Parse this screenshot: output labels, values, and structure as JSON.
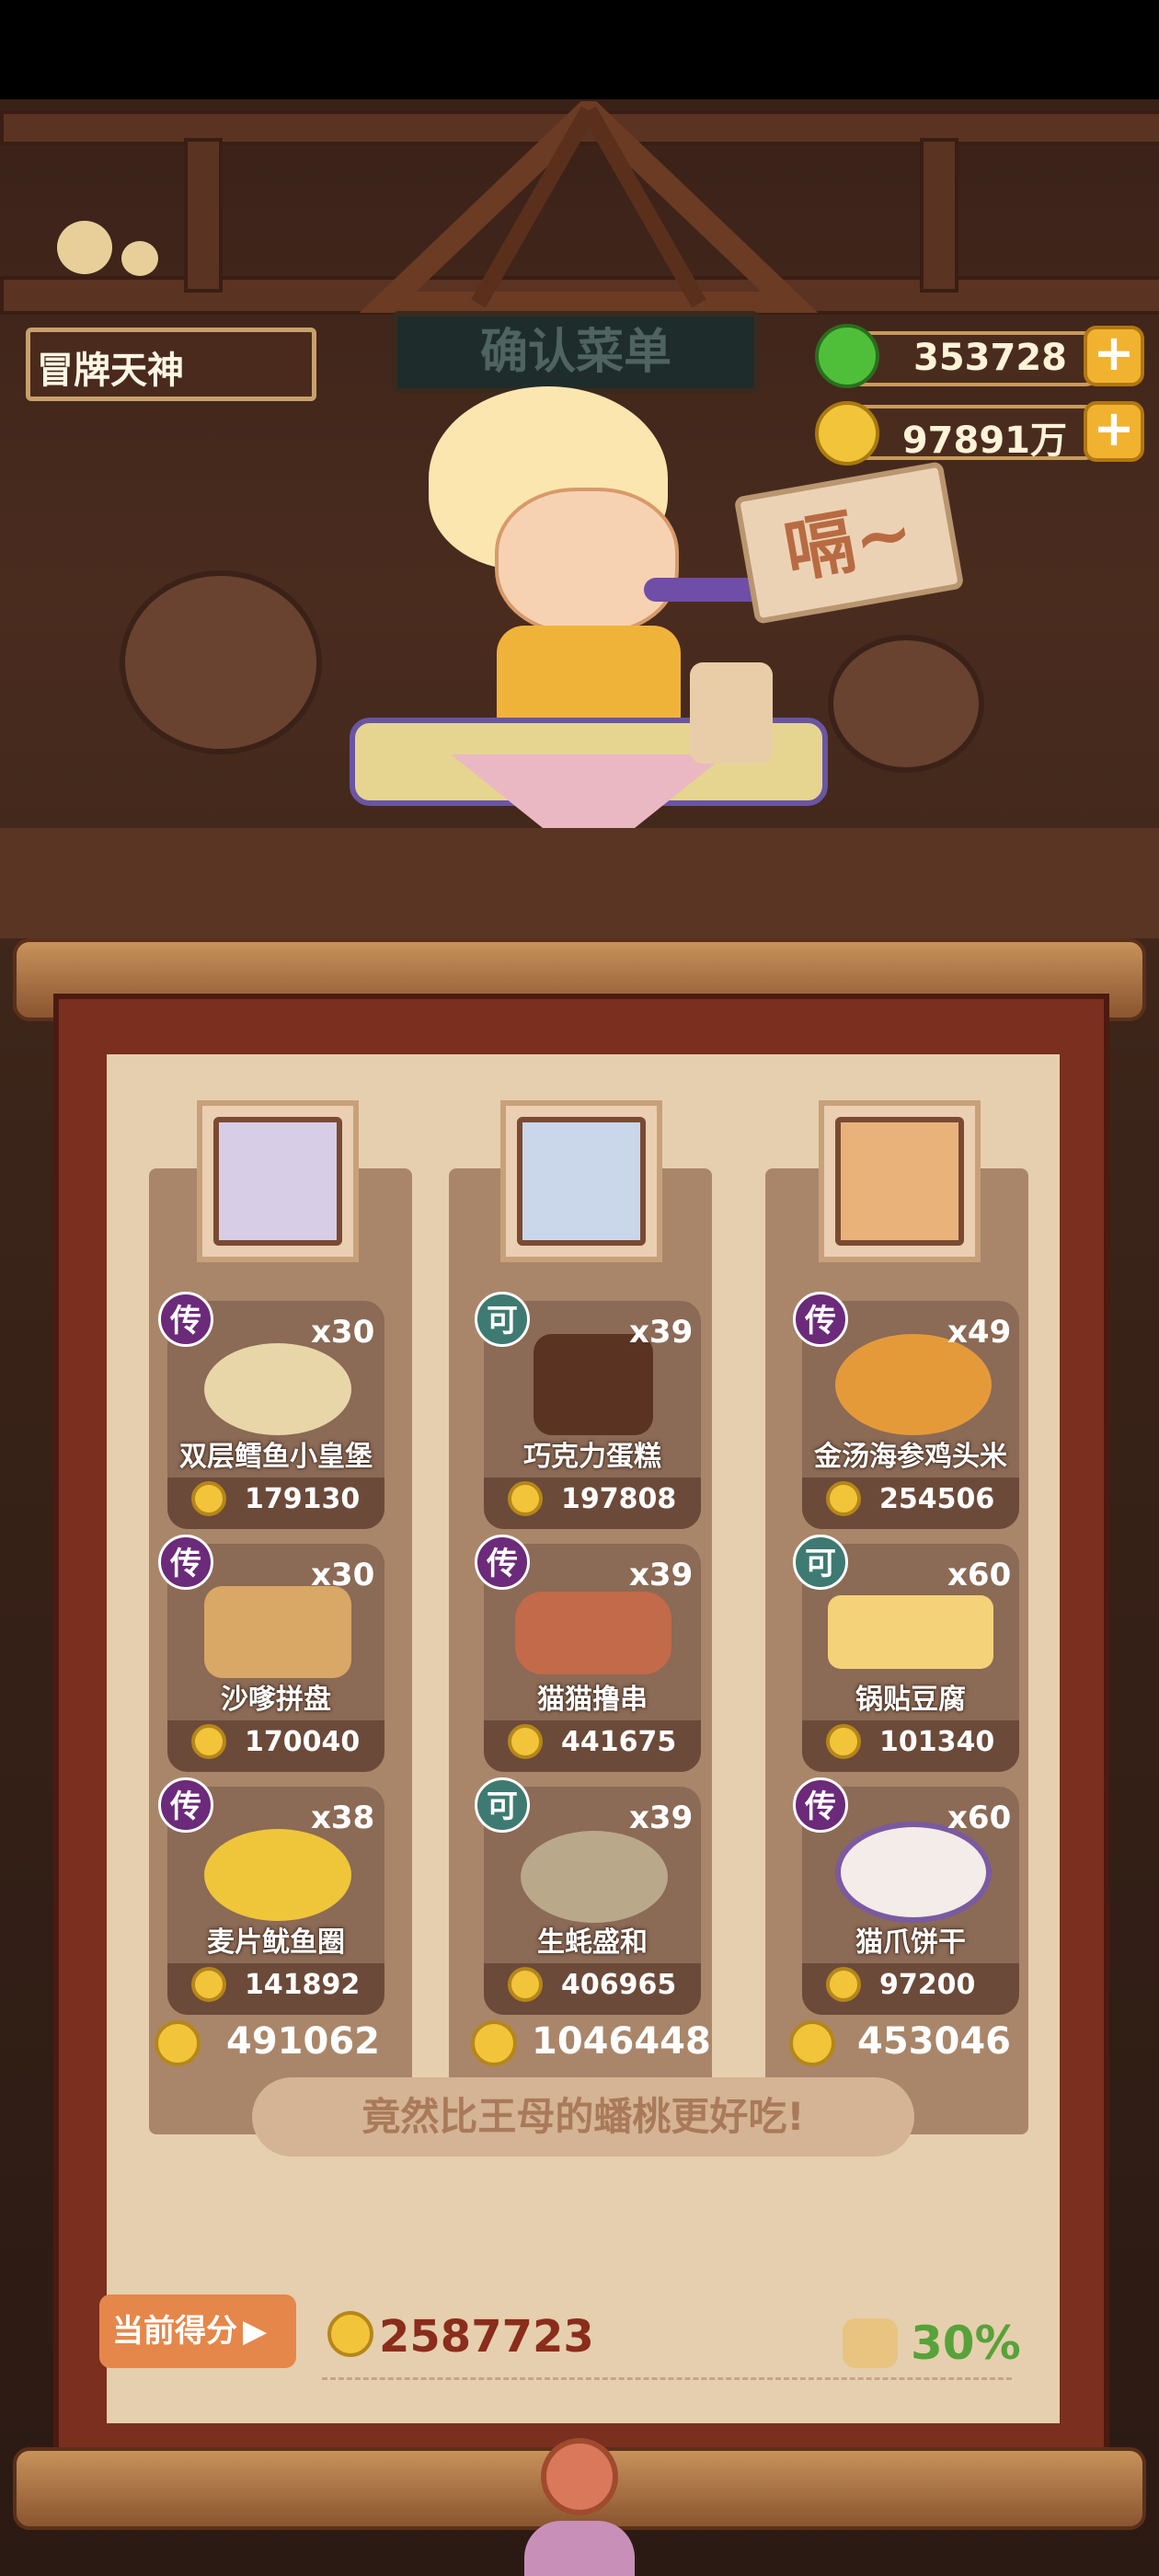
{
  "title": "冒牌天神",
  "resources": {
    "jade": "353728",
    "coins": "97891万"
  },
  "sign_text": "确认菜单",
  "speech": "嗝~",
  "columns": [
    {
      "dishes": [
        {
          "tag": "传",
          "qty": "x30",
          "name": "双层鳕鱼小皇堡",
          "price": "179130"
        },
        {
          "tag": "传",
          "qty": "x30",
          "name": "沙嗲拼盘",
          "price": "170040"
        },
        {
          "tag": "传",
          "qty": "x38",
          "name": "麦片鱿鱼圈",
          "price": "141892"
        }
      ],
      "total": "491062"
    },
    {
      "dishes": [
        {
          "tag": "可",
          "qty": "x39",
          "name": "巧克力蛋糕",
          "price": "197808"
        },
        {
          "tag": "传",
          "qty": "x39",
          "name": "猫猫撸串",
          "price": "441675"
        },
        {
          "tag": "可",
          "qty": "x39",
          "name": "生蚝盛和",
          "price": "406965"
        }
      ],
      "total": "1046448"
    },
    {
      "dishes": [
        {
          "tag": "传",
          "qty": "x49",
          "name": "金汤海参鸡头米",
          "price": "254506"
        },
        {
          "tag": "可",
          "qty": "x60",
          "name": "锅贴豆腐",
          "price": "101340"
        },
        {
          "tag": "传",
          "qty": "x60",
          "name": "猫爪饼干",
          "price": "97200"
        }
      ],
      "total": "453046"
    }
  ],
  "comment": "竟然比王母的蟠桃更好吃!",
  "score_label": "当前得分",
  "score_value": "2587723",
  "bonus_pct": "30%",
  "colors": {
    "tag_legend": "#6b2a7a",
    "tag_rare": "#3e7a72",
    "score_red": "#8a2d1c",
    "bonus_green": "#57a23a"
  }
}
